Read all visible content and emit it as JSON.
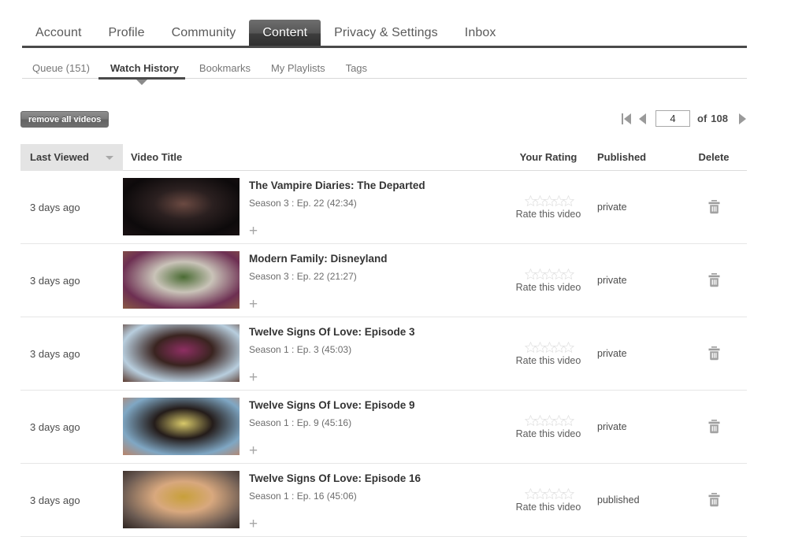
{
  "topnav": {
    "items": [
      {
        "label": "Account",
        "active": false
      },
      {
        "label": "Profile",
        "active": false
      },
      {
        "label": "Community",
        "active": false
      },
      {
        "label": "Content",
        "active": true
      },
      {
        "label": "Privacy & Settings",
        "active": false
      },
      {
        "label": "Inbox",
        "active": false
      }
    ]
  },
  "subnav": {
    "items": [
      {
        "label": "Queue (151)",
        "active": false
      },
      {
        "label": "Watch History",
        "active": true
      },
      {
        "label": "Bookmarks",
        "active": false
      },
      {
        "label": "My Playlists",
        "active": false
      },
      {
        "label": "Tags",
        "active": false
      }
    ]
  },
  "toolbar": {
    "remove_all_label": "remove all videos"
  },
  "pagination": {
    "first_icon": "first-page-icon",
    "prev_icon": "previous-page-icon",
    "next_icon": "next-page-icon",
    "current_page": "4",
    "of_label": "of",
    "total_pages": "108"
  },
  "table": {
    "headers": {
      "last_viewed": "Last Viewed",
      "video_title": "Video Title",
      "your_rating": "Your Rating",
      "published": "Published",
      "delete": "Delete"
    },
    "sort_indicator": "sort-descending-icon",
    "rate_label": "Rate this video",
    "rows": [
      {
        "last_viewed": "3 days ago",
        "title": "The Vampire Diaries: The Departed",
        "subtitle": "Season 3 : Ep. 22   (42:34)",
        "rating": 0,
        "rate_label": "Rate this video",
        "published": "private",
        "thumb_colors": [
          "#0d0a0b",
          "#2b2020",
          "#6b4a42",
          "#1a1113"
        ]
      },
      {
        "last_viewed": "3 days ago",
        "title": "Modern Family: Disneyland",
        "subtitle": "Season 3 : Ep. 22   (21:27)",
        "rating": 0,
        "rate_label": "Rate this video",
        "published": "private",
        "thumb_colors": [
          "#6d2f52",
          "#c9c3b8",
          "#4a6b33",
          "#8a5a45"
        ]
      },
      {
        "last_viewed": "3 days ago",
        "title": "Twelve Signs Of Love: Episode 3",
        "subtitle": "Season 1 : Ep. 3   (45:03)",
        "rating": 0,
        "rate_label": "Rate this video",
        "published": "private",
        "thumb_colors": [
          "#b8cede",
          "#3a2420",
          "#8e2f63",
          "#5b3b30"
        ]
      },
      {
        "last_viewed": "3 days ago",
        "title": "Twelve Signs Of Love: Episode 9",
        "subtitle": "Season 1 : Ep. 9   (45:16)",
        "rating": 0,
        "rate_label": "Rate this video",
        "published": "private",
        "thumb_colors": [
          "#7fa7c4",
          "#241c1a",
          "#d8c96a",
          "#b8846a"
        ]
      },
      {
        "last_viewed": "3 days ago",
        "title": "Twelve Signs Of Love: Episode 16",
        "subtitle": "Season 1 : Ep. 16   (45:06)",
        "rating": 0,
        "rate_label": "Rate this video",
        "published": "published",
        "thumb_colors": [
          "#6a5a52",
          "#d8a87e",
          "#c8a03a",
          "#2e2420"
        ]
      }
    ]
  },
  "colors": {
    "active_tab_bg": "#3d3d3d",
    "rule": "#4a4a4a",
    "header_cell_bg": "#e4e4e4",
    "text": "#3c3c3c",
    "muted": "#767676"
  }
}
